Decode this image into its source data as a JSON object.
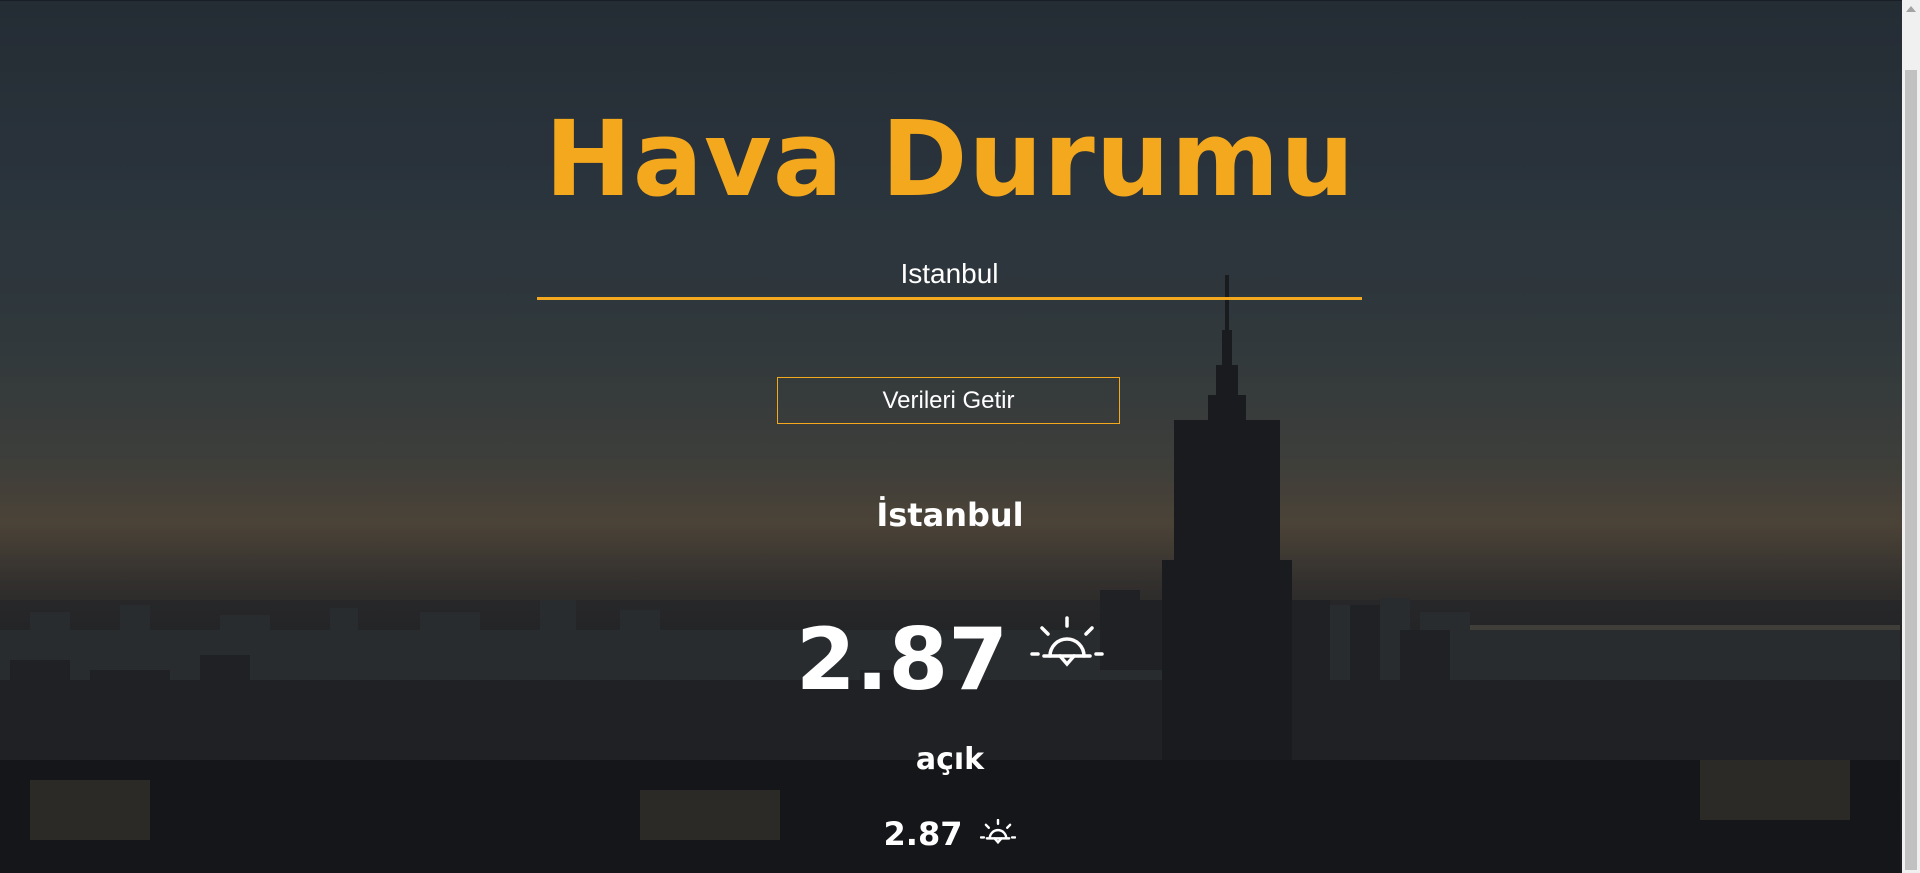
{
  "page": {
    "title": "Hava Durumu",
    "accent_color": "#f4a81d"
  },
  "search": {
    "value": "Istanbul",
    "button_label": "Verileri Getir"
  },
  "weather": {
    "city": "İstanbul",
    "temperature": "2.87",
    "description": "açık",
    "icon": "clear-sky-sun-icon",
    "secondary_temperature": "2.87",
    "secondary_icon": "clear-sky-sun-icon"
  }
}
